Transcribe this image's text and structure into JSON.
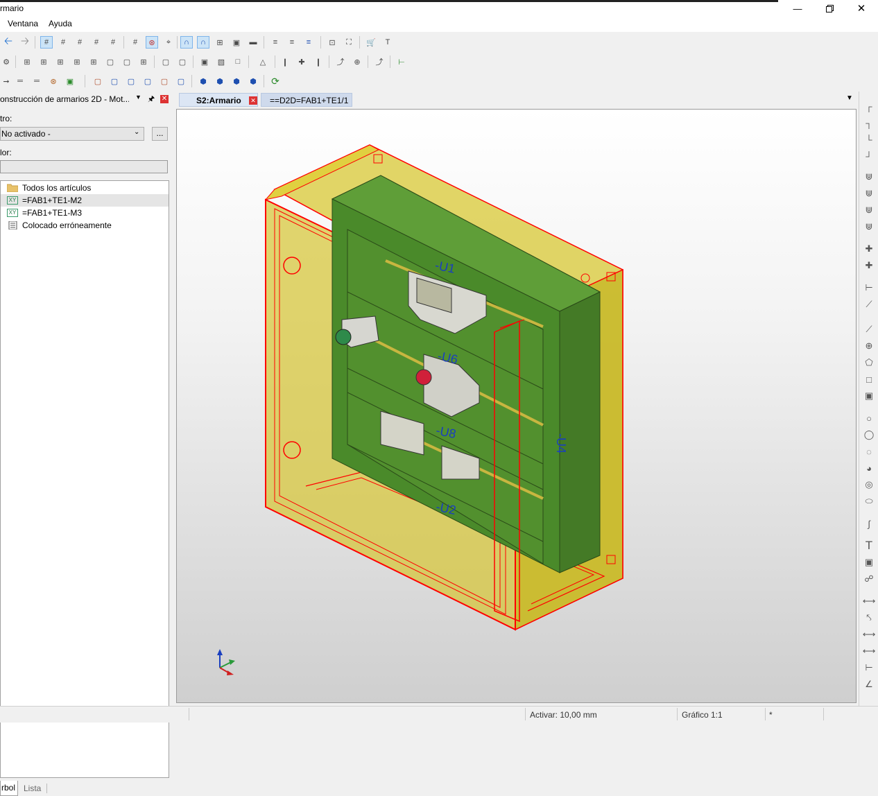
{
  "window": {
    "title": "rmario"
  },
  "menu": [
    "Ventana",
    "Ayuda"
  ],
  "left_panel": {
    "title": "onstrucción de armarios 2D - Mot...",
    "filter_label": "tro:",
    "filter_value": "No activado -",
    "filter_button": "...",
    "value_label": "lor:",
    "value_input": "",
    "tree": [
      {
        "label": "Todos los artículos",
        "icon": "folder-icon"
      },
      {
        "label": "=FAB1+TE1-M2",
        "icon": "xy-icon"
      },
      {
        "label": "=FAB1+TE1-M3",
        "icon": "xy-icon"
      },
      {
        "label": "Colocado erróneamente",
        "icon": "list-icon"
      }
    ],
    "xy_icon_text": "XY",
    "tabs": [
      "rbol",
      "Lista"
    ]
  },
  "doc_tabs": [
    "S2:Armario",
    "==D2D=FAB1+TE1/1"
  ],
  "viewport": {
    "labels": [
      "-U1",
      "-U6",
      "-U8",
      "-U2",
      "-U4"
    ]
  },
  "status": {
    "activar": "Activar: 10,00 mm",
    "grafico": "Gráfico 1:1",
    "star": "*"
  },
  "colors": {
    "enclosure": "#d4c030",
    "plate": "#4e8a2c",
    "outline": "#ff0000",
    "label": "#1a3fbf",
    "tab_active": "#dce6f4"
  }
}
